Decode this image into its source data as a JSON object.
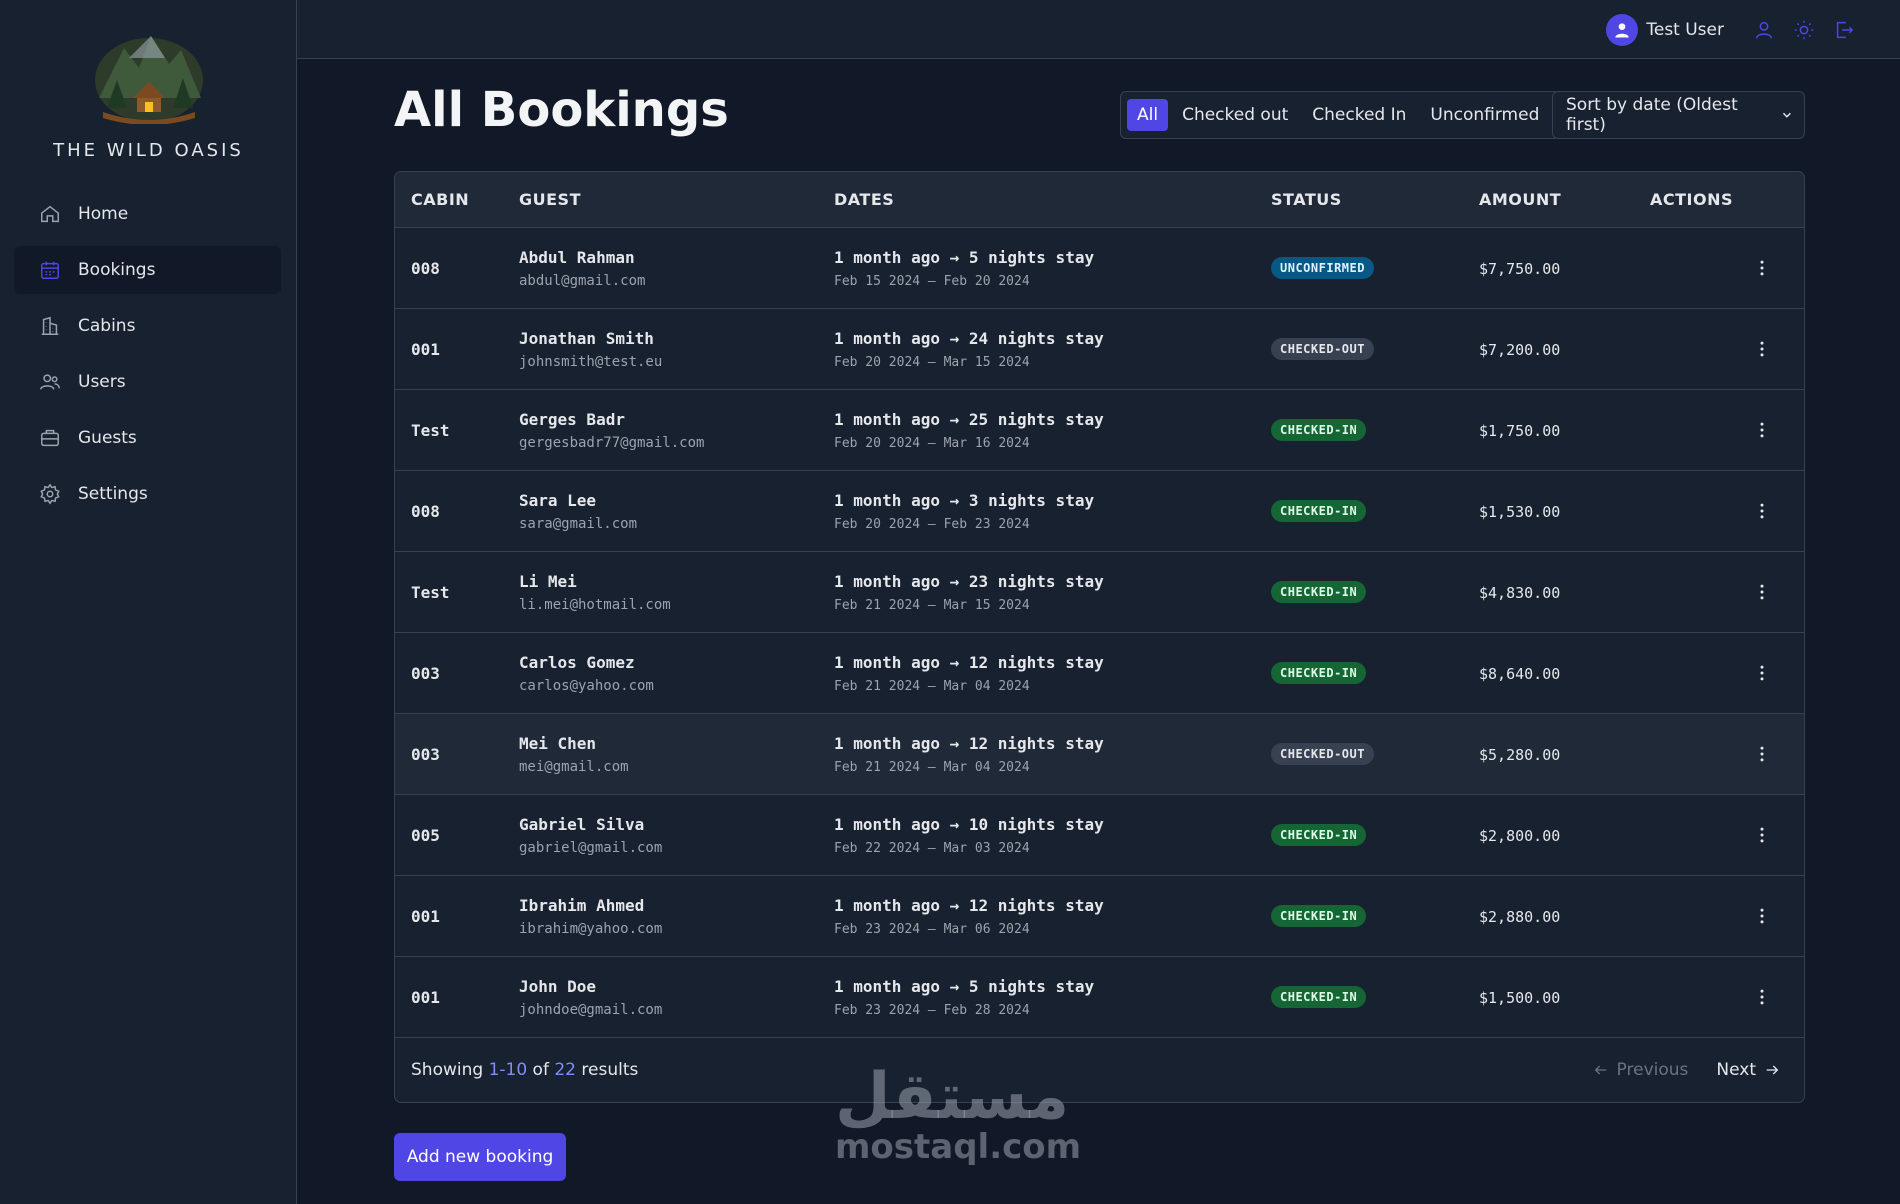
{
  "brand": {
    "name": "THE WILD OASIS"
  },
  "sidebar": {
    "items": [
      {
        "label": "Home",
        "icon": "home-icon",
        "active": false
      },
      {
        "label": "Bookings",
        "icon": "calendar-icon",
        "active": true
      },
      {
        "label": "Cabins",
        "icon": "building-icon",
        "active": false
      },
      {
        "label": "Users",
        "icon": "users-icon",
        "active": false
      },
      {
        "label": "Guests",
        "icon": "briefcase-icon",
        "active": false
      },
      {
        "label": "Settings",
        "icon": "gear-icon",
        "active": false
      }
    ]
  },
  "header": {
    "username": "Test User"
  },
  "page": {
    "title": "All Bookings"
  },
  "filters": [
    "All",
    "Checked out",
    "Checked In",
    "Unconfirmed"
  ],
  "sort": {
    "selected": "Sort by date (Oldest first)"
  },
  "table": {
    "columns": [
      "CABIN",
      "GUEST",
      "DATES",
      "STATUS",
      "AMOUNT",
      "ACTIONS"
    ],
    "rows": [
      {
        "cabin": "008",
        "name": "Abdul Rahman",
        "email": "abdul@gmail.com",
        "stay": "1 month ago → 5 nights stay",
        "range": "Feb 15 2024 — Feb 20 2024",
        "status": "UNCONFIRMED",
        "amount": "$7,750.00"
      },
      {
        "cabin": "001",
        "name": "Jonathan Smith",
        "email": "johnsmith@test.eu",
        "stay": "1 month ago → 24 nights stay",
        "range": "Feb 20 2024 — Mar 15 2024",
        "status": "CHECKED-OUT",
        "amount": "$7,200.00"
      },
      {
        "cabin": "Test",
        "name": "Gerges Badr",
        "email": "gergesbadr77@gmail.com",
        "stay": "1 month ago → 25 nights stay",
        "range": "Feb 20 2024 — Mar 16 2024",
        "status": "CHECKED-IN",
        "amount": "$1,750.00"
      },
      {
        "cabin": "008",
        "name": "Sara Lee",
        "email": "sara@gmail.com",
        "stay": "1 month ago → 3 nights stay",
        "range": "Feb 20 2024 — Feb 23 2024",
        "status": "CHECKED-IN",
        "amount": "$1,530.00"
      },
      {
        "cabin": "Test",
        "name": "Li Mei",
        "email": "li.mei@hotmail.com",
        "stay": "1 month ago → 23 nights stay",
        "range": "Feb 21 2024 — Mar 15 2024",
        "status": "CHECKED-IN",
        "amount": "$4,830.00"
      },
      {
        "cabin": "003",
        "name": "Carlos Gomez",
        "email": "carlos@yahoo.com",
        "stay": "1 month ago → 12 nights stay",
        "range": "Feb 21 2024 — Mar 04 2024",
        "status": "CHECKED-IN",
        "amount": "$8,640.00"
      },
      {
        "cabin": "003",
        "name": "Mei Chen",
        "email": "mei@gmail.com",
        "stay": "1 month ago → 12 nights stay",
        "range": "Feb 21 2024 — Mar 04 2024",
        "status": "CHECKED-OUT",
        "amount": "$5,280.00"
      },
      {
        "cabin": "005",
        "name": "Gabriel Silva",
        "email": "gabriel@gmail.com",
        "stay": "1 month ago → 10 nights stay",
        "range": "Feb 22 2024 — Mar 03 2024",
        "status": "CHECKED-IN",
        "amount": "$2,800.00"
      },
      {
        "cabin": "001",
        "name": "Ibrahim Ahmed",
        "email": "ibrahim@yahoo.com",
        "stay": "1 month ago → 12 nights stay",
        "range": "Feb 23 2024 — Mar 06 2024",
        "status": "CHECKED-IN",
        "amount": "$2,880.00"
      },
      {
        "cabin": "001",
        "name": "John Doe",
        "email": "johndoe@gmail.com",
        "stay": "1 month ago → 5 nights stay",
        "range": "Feb 23 2024 — Feb 28 2024",
        "status": "CHECKED-IN",
        "amount": "$1,500.00"
      }
    ]
  },
  "pagination": {
    "showing_prefix": "Showing ",
    "range": "1-10",
    "of_text": " of ",
    "total": "22",
    "results_text": " results",
    "previous_label": "Previous",
    "next_label": "Next"
  },
  "actions": {
    "add_booking_label": "Add new booking"
  },
  "watermark": {
    "arabic": "مستقل",
    "latin": "mostaql.com"
  },
  "colors": {
    "accent": "#4f46e5",
    "bg": "#111827",
    "panel": "#18212f"
  }
}
